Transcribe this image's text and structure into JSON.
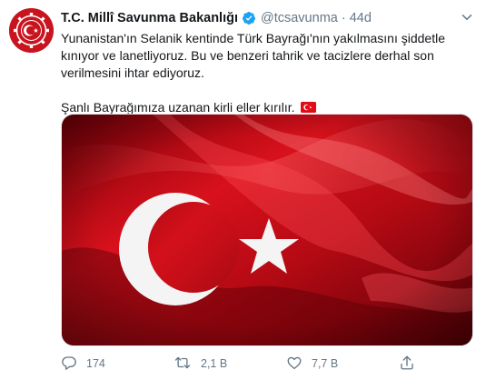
{
  "tweet": {
    "display_name": "T.C. Millî Savunma Bakanlığı",
    "handle": "@tcsavunma",
    "separator": "·",
    "time": "44d",
    "text_line1": "Yunanistan'ın Selanik kentinde Türk Bayrağı'nın yakılmasını şiddetle kınıyor ve lanetliyoruz. Bu ve benzeri tahrik ve tacizlere derhal son verilmesini ihtar ediyoruz.",
    "text_line2": "Şanlı Bayrağımıza uzanan kirli eller kırılır.",
    "media_description_icon": "turkish-flag-image"
  },
  "actions": {
    "reply_count": "174",
    "retweet_count": "2,1 B",
    "like_count": "7,7 B"
  },
  "colors": {
    "accent": "#1da1f2",
    "muted": "#657786",
    "flag_red": "#e30a17"
  }
}
